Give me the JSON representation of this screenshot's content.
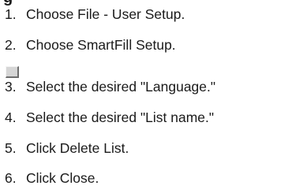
{
  "heading": "g",
  "steps": [
    {
      "number": "1.",
      "text": "Choose File - User Setup."
    },
    {
      "number": "2.",
      "text": "Choose SmartFill Setup."
    },
    {
      "number": "3.",
      "text": "Select the desired \"Language.\""
    },
    {
      "number": "4.",
      "text": "Select the desired \"List name.\""
    },
    {
      "number": "5.",
      "text": "Click Delete List."
    },
    {
      "number": "6.",
      "text": "Click Close."
    }
  ],
  "image_placeholder_icon": "broken-image-icon"
}
